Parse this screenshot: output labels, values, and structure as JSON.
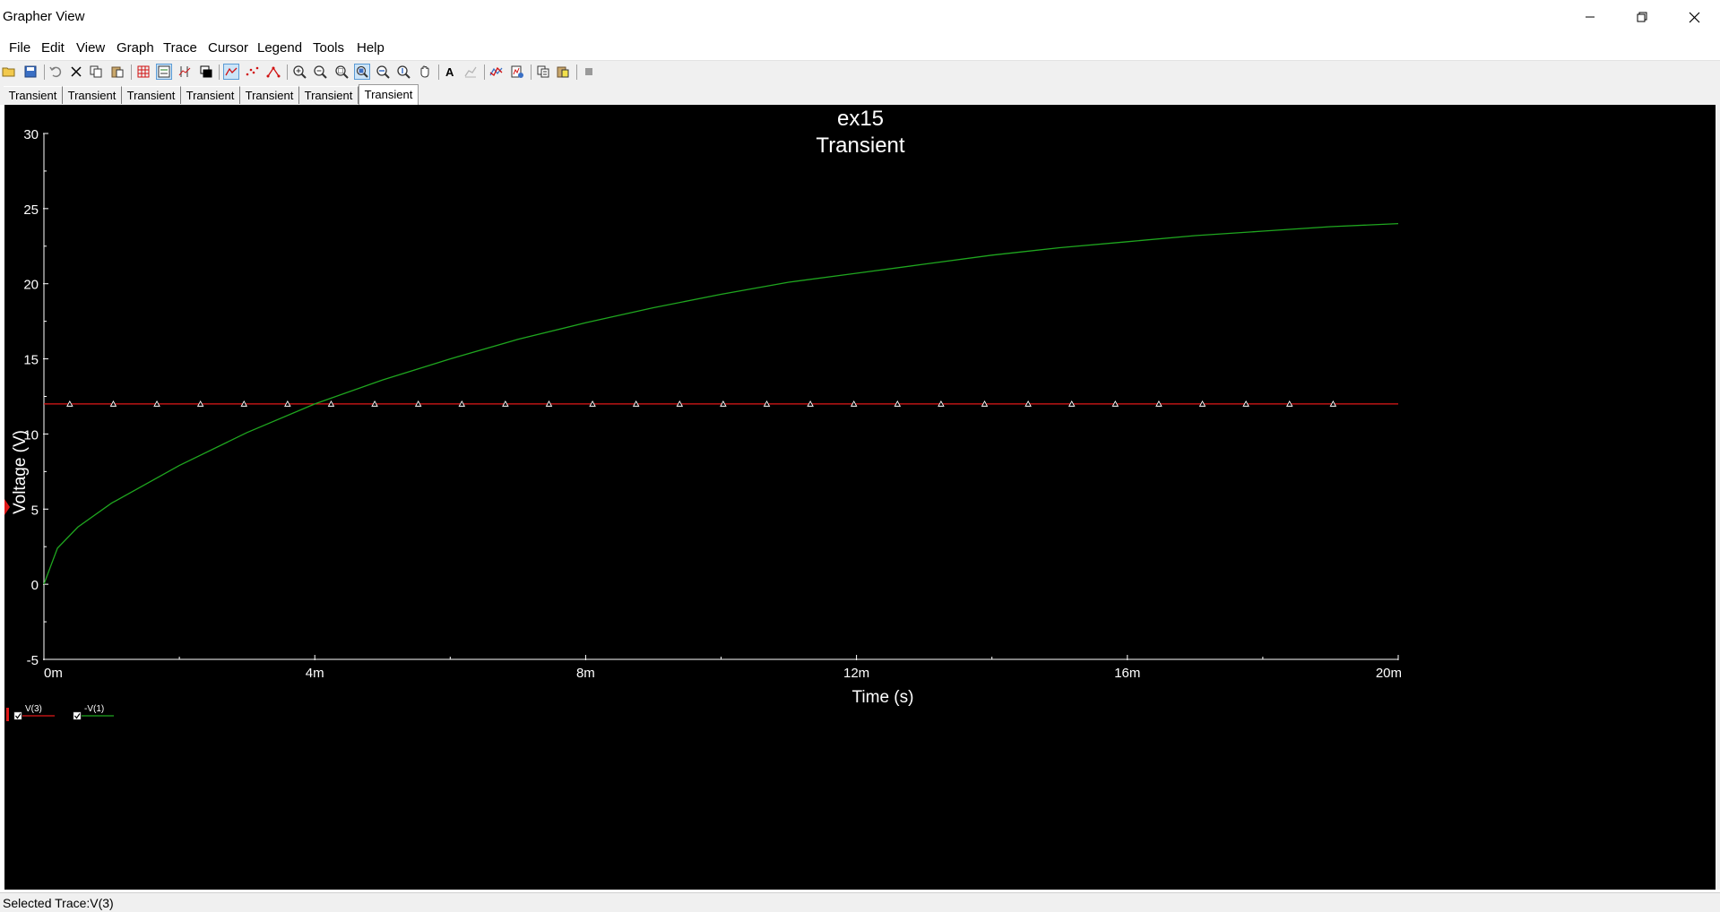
{
  "window": {
    "title": "Grapher View"
  },
  "menu": [
    "File",
    "Edit",
    "View",
    "Graph",
    "Trace",
    "Cursor",
    "Legend",
    "Tools",
    "Help"
  ],
  "toolbar": {
    "icons": [
      "open-icon",
      "save-icon",
      "undo-icon",
      "cut-icon",
      "copy-icon",
      "paste-icon",
      "grid-icon",
      "legend-icon",
      "cursors-icon",
      "overlay-icon",
      "trace-line-icon",
      "trace-points-icon",
      "trace-line-points-icon",
      "zoom-in-icon",
      "zoom-out-icon",
      "zoom-area-icon",
      "zoom-full-icon",
      "zoom-x-icon",
      "zoom-y-icon",
      "pan-icon",
      "text-icon",
      "fit-icon",
      "select-trace-icon",
      "export-icon",
      "copy-graph-icon",
      "paste-graph-icon",
      "stop-icon"
    ]
  },
  "tabs": [
    "Transient",
    "Transient",
    "Transient",
    "Transient",
    "Transient",
    "Transient",
    "Transient"
  ],
  "active_tab": 6,
  "chart_data": {
    "type": "line",
    "title": "ex15",
    "subtitle": "Transient",
    "xlabel": "Time (s)",
    "ylabel": "Voltage (V)",
    "xlim": [
      0,
      0.02
    ],
    "ylim": [
      -5,
      30
    ],
    "xticks": [
      0,
      0.004,
      0.008,
      0.012,
      0.016,
      0.02
    ],
    "xtick_labels": [
      "0m",
      "4m",
      "8m",
      "12m",
      "16m",
      "20m"
    ],
    "yticks": [
      -5,
      0,
      5,
      10,
      15,
      20,
      25,
      30
    ],
    "ytick_labels": [
      "-5",
      "0",
      "5",
      "10",
      "15",
      "20",
      "25",
      "30"
    ],
    "grid": false,
    "series": [
      {
        "name": "V(3)",
        "color": "#e01818",
        "marker": "triangle-outline",
        "x": [
          0,
          0.02
        ],
        "y": [
          12,
          12
        ]
      },
      {
        "name": "-V(1)",
        "color": "#1fa61f",
        "marker": "none",
        "x": [
          0,
          0.0002,
          0.0005,
          0.001,
          0.002,
          0.003,
          0.004,
          0.005,
          0.006,
          0.007,
          0.008,
          0.009,
          0.01,
          0.011,
          0.012,
          0.013,
          0.014,
          0.015,
          0.016,
          0.017,
          0.018,
          0.019,
          0.02
        ],
        "y": [
          0,
          2.4,
          3.8,
          5.4,
          7.9,
          10.1,
          12,
          13.6,
          15.0,
          16.3,
          17.4,
          18.4,
          19.3,
          20.1,
          20.7,
          21.3,
          21.9,
          22.4,
          22.8,
          23.2,
          23.5,
          23.8,
          24.0
        ]
      }
    ],
    "legend_position": "bottom-left"
  },
  "status": {
    "text": "Selected Trace:V(3)"
  }
}
